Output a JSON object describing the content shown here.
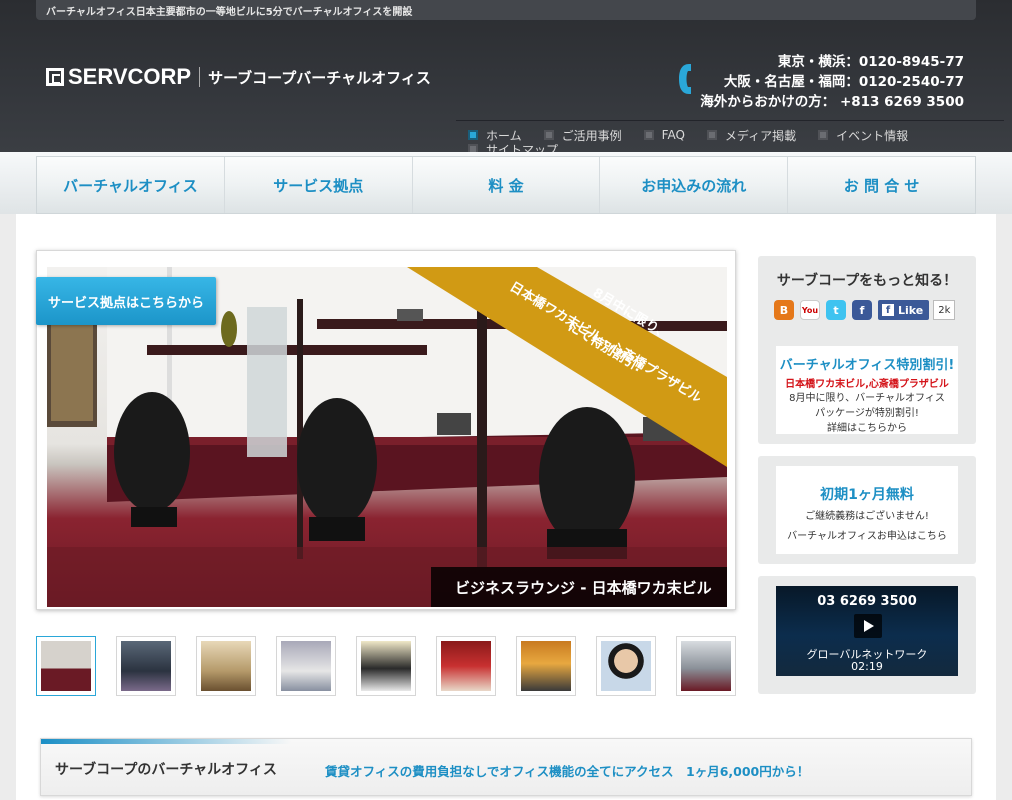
{
  "topbar": {
    "text": "バーチャルオフィス日本主要都市の一等地ビルに5分でバーチャルオフィスを開設"
  },
  "logo": {
    "brand": "SERVCORP",
    "subtitle": "サーブコープバーチャルオフィス"
  },
  "phones": {
    "line1": "東京・横浜：0120-8945-77",
    "line2": "大阪・名古屋・福岡：0120-2540-77",
    "line3": "海外からおかけの方：  +813 6269 3500"
  },
  "subnav": {
    "items": [
      {
        "label": "ホーム"
      },
      {
        "label": "ご活用事例"
      },
      {
        "label": "FAQ"
      },
      {
        "label": "メディア掲載"
      },
      {
        "label": "イベント情報"
      },
      {
        "label": "サイトマップ"
      }
    ]
  },
  "mainnav": {
    "items": [
      {
        "label": "バーチャルオフィス"
      },
      {
        "label": "サービス拠点"
      },
      {
        "label": "料 金"
      },
      {
        "label": "お申込みの流れ"
      },
      {
        "label": "お 問 合 せ"
      }
    ]
  },
  "slider": {
    "button": "サービス拠点はこちらから",
    "ribbon_line1": "8月中に限り、",
    "ribbon_line2": "日本橋ワカ末ビル・心斎橋プラザビル",
    "ribbon_line3": "にて特別割引!",
    "caption": "ビジネスラウンジ -  日本橋ワカ末ビル"
  },
  "sidebar": {
    "social_title": "サーブコープをもっと知る！",
    "social_icons": [
      "blogger-icon",
      "youtube-icon",
      "twitter-icon",
      "facebook-icon"
    ],
    "like_label": "Like",
    "like_count": "2k",
    "promo1": {
      "title": "バーチャルオフィス特別割引!",
      "subtitle": "日本橋ワカ末ビル,心斎橋プラザビル",
      "line1": "8月中に限り、バーチャルオフィス",
      "line2": "パッケージが特別割引!",
      "line3": "詳細はこちらから"
    },
    "promo2": {
      "title": "初期1ヶ月無料",
      "line1": "ご継続義務はございません!",
      "line2": "バーチャルオフィスお申込はこちら"
    },
    "video": {
      "phone": "03 6269 3500",
      "title": "グローバルネットワーク",
      "duration": "02:19"
    }
  },
  "banner": {
    "title": "サーブコープのバーチャルオフィス",
    "text": "賃貸オフィスの費用負担なしでオフィス機能の全てにアクセス　1ヶ月6,000円から！"
  },
  "colors": {
    "accent": "#1d8fc4",
    "header": "#2f3236",
    "ribbon": "#d19a14",
    "carpet": "#7a1f2b"
  }
}
